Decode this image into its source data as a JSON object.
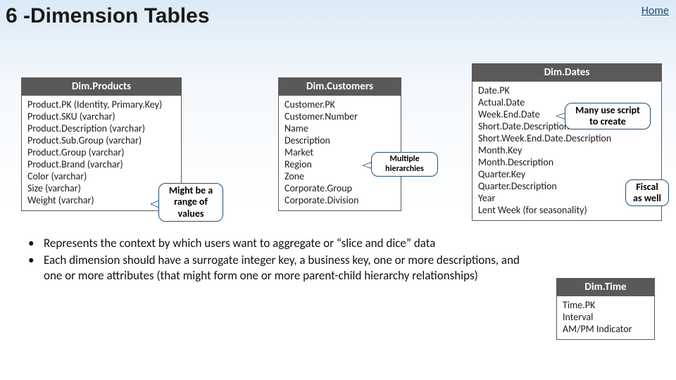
{
  "header": {
    "title": "6 -Dimension Tables",
    "home_link": "Home"
  },
  "tables": {
    "products": {
      "title": "Dim.Products",
      "rows": [
        "Product.PK  (Identity, Primary.Key)",
        "Product.SKU  (varchar)",
        "Product.Description (varchar)",
        "Product.Sub.Group (varchar)",
        "Product.Group (varchar)",
        "Product.Brand (varchar)",
        "Color  (varchar)",
        "Size  (varchar)",
        "Weight (varchar)"
      ]
    },
    "customers": {
      "title": "Dim.Customers",
      "rows": [
        "Customer.PK",
        "Customer.Number",
        "Name",
        "Description",
        "Market",
        "Region",
        "Zone",
        "Corporate.Group",
        "Corporate.Division"
      ]
    },
    "dates": {
      "title": "Dim.Dates",
      "rows": [
        "Date.PK",
        "Actual.Date",
        "Week.End.Date",
        "Short.Date.Description",
        "Short.Week.End.Date.Description",
        "Month.Key",
        "Month.Description",
        "Quarter.Key",
        "Quarter.Description",
        "Year",
        "Lent Week (for seasonality)"
      ]
    },
    "time": {
      "title": "Dim.Time",
      "rows": [
        "Time.PK",
        "Interval",
        "AM/PM Indicator"
      ]
    }
  },
  "callouts": {
    "range": "Might be a range of values",
    "multiple": "Multiple hierarchies",
    "script": "Many use script to create",
    "fiscal": "Fiscal as well"
  },
  "bullets": [
    "Represents the context by which users want to aggregate or “slice and dice” data",
    "Each dimension should have a surrogate integer key, a business key, one or more descriptions, and one or more attributes (that might form one or more parent-child hierarchy relationships)"
  ]
}
